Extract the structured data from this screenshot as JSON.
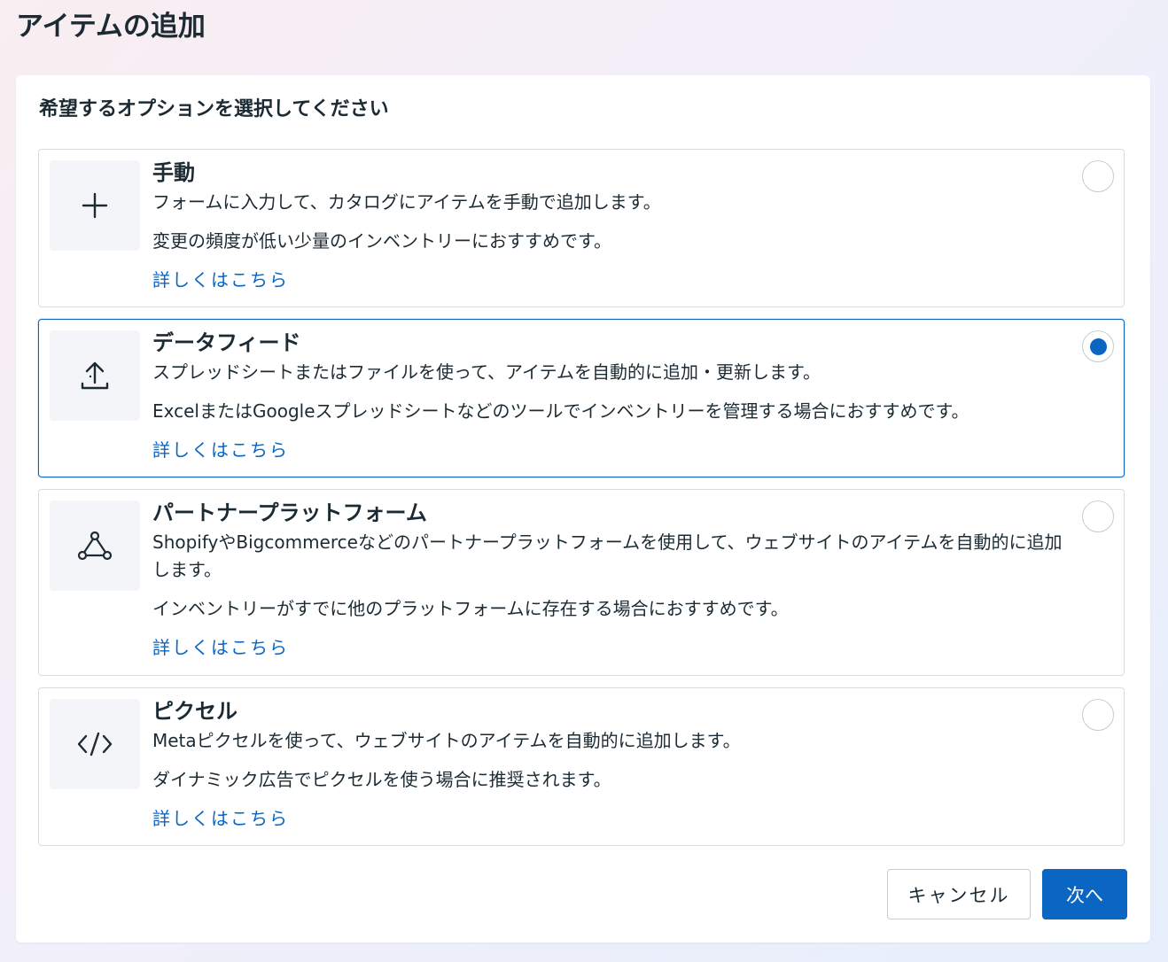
{
  "header": {
    "title": "アイテムの追加"
  },
  "main": {
    "prompt": "希望するオプションを選択してください",
    "link_label": "詳しくはこちら",
    "options": [
      {
        "title": "手動",
        "description": "フォームに入力して、カタログにアイテムを手動で追加します。",
        "note": "変更の頻度が低い少量のインベントリーにおすすめです。",
        "link": "詳しくはこちら",
        "icon": "plus-icon",
        "selected": false
      },
      {
        "title": "データフィード",
        "description": "スプレッドシートまたはファイルを使って、アイテムを自動的に追加・更新します。",
        "note": "ExcelまたはGoogleスプレッドシートなどのツールでインベントリーを管理する場合におすすめです。",
        "link": "詳しくはこちら",
        "icon": "upload-icon",
        "selected": true
      },
      {
        "title": "パートナープラットフォーム",
        "description": "ShopifyやBigcommerceなどのパートナープラットフォームを使用して、ウェブサイトのアイテムを自動的に追加します。",
        "note": "インベントリーがすでに他のプラットフォームに存在する場合におすすめです。",
        "link": "詳しくはこちら",
        "icon": "network-icon",
        "selected": false
      },
      {
        "title": "ピクセル",
        "description": "Metaピクセルを使って、ウェブサイトのアイテムを自動的に追加します。",
        "note": "ダイナミック広告でピクセルを使う場合に推奨されます。",
        "link": "詳しくはこちら",
        "icon": "code-icon",
        "selected": false
      }
    ]
  },
  "footer": {
    "cancel_label": "キャンセル",
    "next_label": "次へ"
  },
  "colors": {
    "accent": "#0a66c2",
    "text": "#1c2b33",
    "border": "#d8dce0"
  }
}
